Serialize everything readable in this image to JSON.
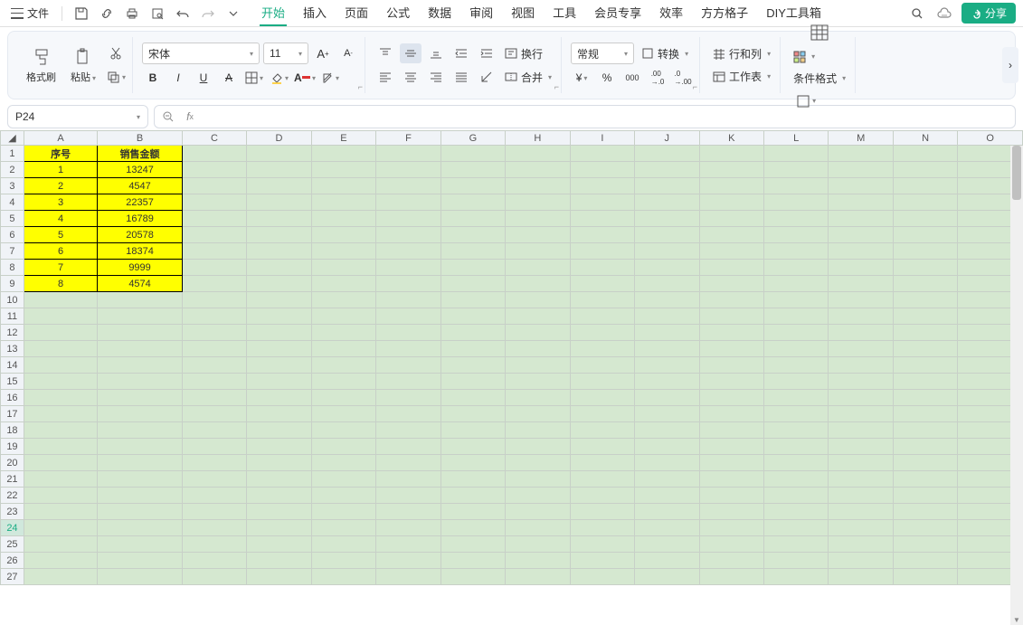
{
  "menu": {
    "file": "文件",
    "tabs": [
      "开始",
      "插入",
      "页面",
      "公式",
      "数据",
      "审阅",
      "视图",
      "工具",
      "会员专享",
      "效率",
      "方方格子",
      "DIY工具箱"
    ],
    "active_tab": 0,
    "share": "分享"
  },
  "ribbon": {
    "format_painter": "格式刷",
    "paste": "粘贴",
    "font_name": "宋体",
    "font_size": "11",
    "wrap": "换行",
    "merge": "合并",
    "number_format": "常规",
    "convert": "转换",
    "rows_cols": "行和列",
    "worksheet": "工作表",
    "cond_format": "条件格式"
  },
  "namebox": "P24",
  "formula": "",
  "columns": [
    "A",
    "B",
    "C",
    "D",
    "E",
    "F",
    "G",
    "H",
    "I",
    "J",
    "K",
    "L",
    "M",
    "N",
    "O"
  ],
  "rows": [
    1,
    2,
    3,
    4,
    5,
    6,
    7,
    8,
    9,
    10,
    11,
    12,
    13,
    14,
    15,
    16,
    17,
    18,
    19,
    20,
    21,
    22,
    23,
    24,
    25,
    26,
    27
  ],
  "active_row": 24,
  "table": {
    "headers": [
      "序号",
      "销售金额"
    ],
    "data": [
      [
        "1",
        "13247"
      ],
      [
        "2",
        "4547"
      ],
      [
        "3",
        "22357"
      ],
      [
        "4",
        "16789"
      ],
      [
        "5",
        "20578"
      ],
      [
        "6",
        "18374"
      ],
      [
        "7",
        "9999"
      ],
      [
        "8",
        "4574"
      ]
    ]
  }
}
